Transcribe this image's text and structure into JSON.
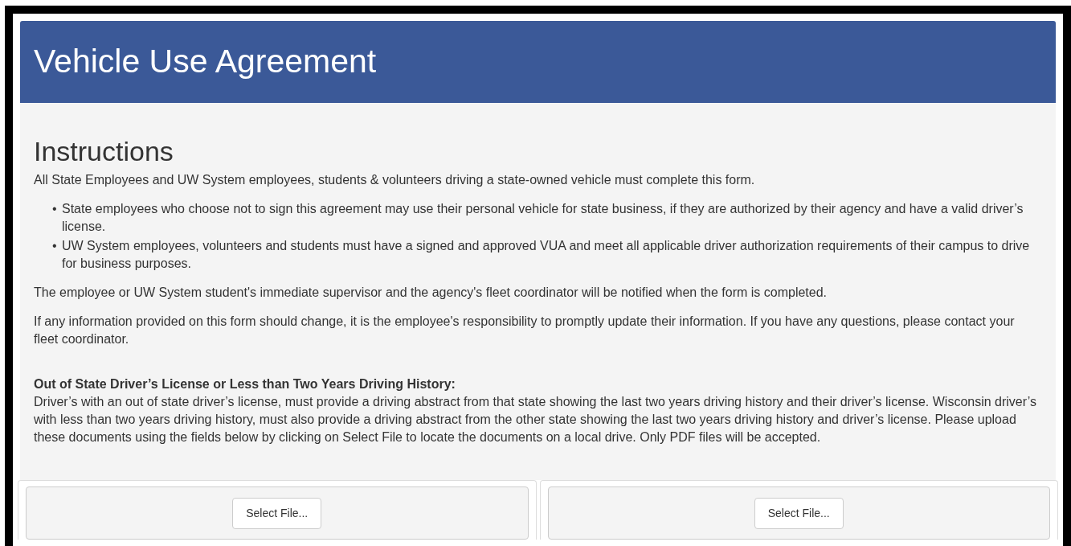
{
  "header": {
    "title": "Vehicle Use Agreement"
  },
  "instructions": {
    "heading": "Instructions",
    "intro": "All State Employees and UW System employees, students & volunteers driving a state-owned vehicle must complete this form.",
    "bullets": [
      {
        "marker": "•",
        "text": "State employees who choose not to sign this agreement may use their personal vehicle for state business, if they are authorized by their agency and have a valid driver’s license."
      },
      {
        "marker": "•",
        "text": "UW System employees, volunteers and students must have a signed and approved VUA and meet all applicable driver authorization requirements of their campus to drive for business purposes."
      }
    ],
    "paragraphs": [
      "The employee or UW System student's immediate supervisor and the agency's fleet coordinator will be notified when the form is completed.",
      "If any information provided on this form should change, it is the employee's responsibility to promptly update their information. If you have any questions, please contact your fleet coordinator."
    ]
  },
  "out_of_state": {
    "heading": "Out of State Driver’s License or Less than Two Years Driving History:",
    "body": "Driver’s with an out of state driver’s license, must provide a driving abstract from that state showing the last two years driving history and their driver’s license. Wisconsin driver’s with less than two years driving history, must also provide a driving abstract from the other state showing the last two years driving history and driver’s license. Please upload these documents using the fields below by clicking on Select File to locate the documents on a local drive. Only PDF files will be accepted."
  },
  "uploads": [
    {
      "button": "Select File..."
    },
    {
      "button": "Select File..."
    }
  ]
}
